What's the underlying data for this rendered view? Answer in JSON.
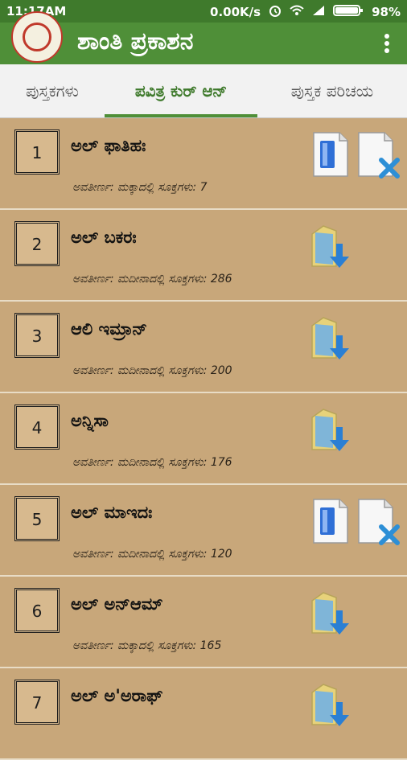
{
  "status": {
    "time": "11:17AM",
    "speed": "0.00K/s",
    "battery": "98%"
  },
  "app": {
    "title": "ಶಾಂತಿ ಪ್ರಕಾಶನ",
    "logo_icon": "shanti-prakashana-logo",
    "menu_icon": "overflow-menu-icon"
  },
  "tabs": [
    {
      "label": "ಪುಸ್ತಕಗಳು",
      "active": false
    },
    {
      "label": "ಪವಿತ್ರ ಕುರ್ ಆನ್",
      "active": true
    },
    {
      "label": "ಪುಸ್ತಕ ಪರಿಚಯ",
      "active": false
    }
  ],
  "surahs": [
    {
      "number": "1",
      "name": "ಅಲ್ ಫಾತಿಹಃ",
      "meta": "ಅವತೀರ್ಣ: ಮಕ್ಕಾದಲ್ಲಿ  ಸೂಕ್ತಗಳು: 7",
      "downloaded": true
    },
    {
      "number": "2",
      "name": "ಅಲ್ ಬಕರಃ",
      "meta": "ಅವತೀರ್ಣ: ಮದೀನಾದಲ್ಲಿ  ಸೂಕ್ತಗಳು: 286",
      "downloaded": false
    },
    {
      "number": "3",
      "name": "ಆಲಿ ಇಮ್ರಾನ್",
      "meta": "ಅವತೀರ್ಣ: ಮದೀನಾದಲ್ಲಿ  ಸೂಕ್ತಗಳು: 200",
      "downloaded": false
    },
    {
      "number": "4",
      "name": "ಅನ್ನಿಸಾ",
      "meta": "ಅವತೀರ್ಣ: ಮದೀನಾದಲ್ಲಿ  ಸೂಕ್ತಗಳು: 176",
      "downloaded": false
    },
    {
      "number": "5",
      "name": "ಅಲ್ ಮಾಇದಃ",
      "meta": "ಅವತೀರ್ಣ: ಮದೀನಾದಲ್ಲಿ  ಸೂಕ್ತಗಳು: 120",
      "downloaded": true
    },
    {
      "number": "6",
      "name": "ಅಲ್ ಅನ್‌ಆಮ್",
      "meta": "ಅವತೀರ್ಣ: ಮಕ್ಕಾದಲ್ಲಿ  ಸೂಕ್ತಗಳು: 165",
      "downloaded": false
    },
    {
      "number": "7",
      "name": "ಅಲ್ ಅ'ಅರಾಫ್",
      "meta": "",
      "downloaded": false
    }
  ],
  "colors": {
    "statusbar": "#3f7a2c",
    "appbar": "#4f8f38",
    "list_bg": "#c8a77a",
    "tab_bg": "#f2f2f2"
  }
}
